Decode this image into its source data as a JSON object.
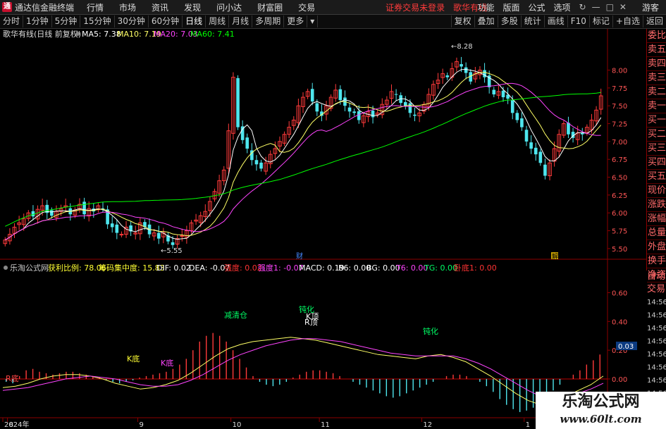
{
  "app": {
    "title": "通达信金融终端",
    "user": "游客"
  },
  "menu": [
    "行情",
    "市场",
    "资讯",
    "发现",
    "问小达",
    "财富圈",
    "交易"
  ],
  "notice": {
    "login": "证券交易未登录",
    "stock": "歌华有线"
  },
  "menu_right": [
    "功能",
    "版面",
    "公式",
    "选项"
  ],
  "periods": [
    "分时",
    "1分钟",
    "5分钟",
    "15分钟",
    "30分钟",
    "60分钟",
    "日线",
    "周线",
    "月线",
    "多周期",
    "更多"
  ],
  "active_period": "日线",
  "toolbar_right": [
    "复权",
    "叠加",
    "多股",
    "统计",
    "画线",
    "F10",
    "标记",
    "+自选",
    "返回"
  ],
  "side_items": [
    "委比",
    "卖五",
    "卖四",
    "卖三",
    "卖二",
    "卖一",
    "买一",
    "买二",
    "买三",
    "买四",
    "买五",
    "现价",
    "涨跌",
    "涨幅",
    "总量",
    "外盘",
    "换手",
    "净资",
    "收益"
  ],
  "side_items_2": [
    "自动",
    "交易"
  ],
  "watermark": {
    "title": "乐淘公式网",
    "url": "www.60lt.com"
  },
  "main_legend": {
    "name": "歌华有线(日线 前复权)",
    "ma": [
      {
        "label": "MA5: 7.38",
        "color": "#ffffff"
      },
      {
        "label": "MA10: 7.19",
        "color": "#ffff66"
      },
      {
        "label": "MA20: 7.03",
        "color": "#ff44ff"
      },
      {
        "label": "MA60: 7.41",
        "color": "#00ff00"
      }
    ]
  },
  "sub_legend": [
    {
      "label": "乐淘公式网",
      "color": "#cccccc"
    },
    {
      "label": "获利比例: 78.06",
      "color": "#ffff33"
    },
    {
      "label": "筹码集中度: 15.83",
      "color": "#ffff33"
    },
    {
      "label": "DIF: 0.02",
      "color": "#ffffff"
    },
    {
      "label": "DEA: -0.07",
      "color": "#ffffff"
    },
    {
      "label": "强度: 0.02",
      "color": "#ff3333"
    },
    {
      "label": "强度1: -0.07",
      "color": "#ff44ff"
    },
    {
      "label": "MACD: 0.19",
      "color": "#ffffff"
    },
    {
      "label": "B6: 0.00",
      "color": "#ffffff"
    },
    {
      "label": "BG: 0.00",
      "color": "#ffffff"
    },
    {
      "label": "T6: 0.00",
      "color": "#ff44ff"
    },
    {
      "label": "TG: 0.00",
      "color": "#00ff66"
    },
    {
      "label": "卧底1: 0.00",
      "color": "#ff3333"
    }
  ],
  "annotations": {
    "high_label": "8.28",
    "low_label": "5.55",
    "cai_label": "财",
    "jie_label": "解",
    "sub_labels": [
      {
        "text": "R底",
        "color": "#ff4444"
      },
      {
        "text": "K底",
        "color": "#ffff33"
      },
      {
        "text": "K底",
        "color": "#ff44ff"
      },
      {
        "text": "减清仓",
        "color": "#00ff66"
      },
      {
        "text": "钝化",
        "color": "#00ff66"
      },
      {
        "text": "K顶",
        "color": "#ffffff"
      },
      {
        "text": "R顶",
        "color": "#ffffff"
      },
      {
        "text": "钝化",
        "color": "#00ff66"
      }
    ],
    "macd_value": "0.03"
  },
  "chart_data": {
    "type": "candlestick",
    "price_axis": {
      "ticks": [
        5.5,
        5.75,
        6.0,
        6.25,
        6.5,
        6.75,
        7.0,
        7.25,
        7.5,
        7.75,
        8.0
      ],
      "range": [
        5.4,
        8.4
      ]
    },
    "sub_axis": {
      "ticks": [
        -0.2,
        0.0,
        0.2,
        0.4,
        0.6
      ],
      "range": [
        -0.25,
        0.72
      ]
    },
    "date_axis": [
      {
        "label": "2024年",
        "index": 0
      },
      {
        "label": "8",
        "index": 1
      },
      {
        "label": "9",
        "index": 29
      },
      {
        "label": "10",
        "index": 49
      },
      {
        "label": "11",
        "index": 68
      },
      {
        "label": "12",
        "index": 90
      },
      {
        "label": "1",
        "index": 112
      }
    ],
    "right_time_ticks": [
      "14:56",
      "14:56",
      "14:56",
      "14:56",
      "14:56",
      "14:56",
      "14:56",
      "14:56"
    ],
    "closes": [
      5.62,
      5.7,
      5.8,
      5.86,
      5.92,
      6.0,
      5.95,
      6.05,
      6.1,
      6.0,
      5.96,
      6.02,
      6.06,
      6.1,
      5.98,
      6.04,
      6.12,
      5.98,
      6.06,
      6.02,
      6.1,
      6.06,
      5.84,
      5.8,
      5.72,
      5.7,
      5.8,
      5.74,
      5.72,
      5.86,
      5.8,
      5.7,
      5.72,
      5.64,
      5.72,
      5.6,
      5.55,
      5.64,
      5.68,
      5.75,
      5.86,
      5.9,
      5.96,
      6.02,
      6.16,
      6.3,
      6.45,
      6.6,
      7.15,
      7.9,
      7.2,
      7.02,
      6.9,
      6.74,
      6.68,
      6.62,
      6.7,
      6.82,
      6.9,
      7.0,
      7.1,
      7.2,
      7.3,
      7.5,
      7.62,
      7.7,
      7.56,
      7.42,
      7.36,
      7.5,
      7.62,
      7.72,
      7.58,
      7.5,
      7.42,
      7.4,
      7.3,
      7.36,
      7.42,
      7.34,
      7.4,
      7.52,
      7.58,
      7.7,
      7.66,
      7.54,
      7.5,
      7.4,
      7.36,
      7.4,
      7.52,
      7.66,
      7.8,
      7.86,
      7.95,
      7.9,
      8.02,
      8.12,
      8.05,
      7.96,
      7.84,
      7.96,
      8.0,
      7.9,
      7.76,
      7.66,
      7.7,
      7.62,
      7.6,
      7.4,
      7.3,
      7.2,
      7.0,
      6.9,
      6.82,
      6.7,
      6.52,
      6.7,
      6.9,
      7.1,
      7.25,
      7.1,
      7.05,
      7.12,
      7.1,
      7.2,
      7.3,
      7.44,
      7.64
    ],
    "ma": [
      {
        "name": "MA5",
        "color": "#ffffff",
        "values": []
      },
      {
        "name": "MA10",
        "color": "#ffff66",
        "values": []
      },
      {
        "name": "MA20",
        "color": "#ff44ff",
        "values": []
      },
      {
        "name": "MA60",
        "color": "#00ff00",
        "values": []
      }
    ],
    "macd_hist": [
      -0.02,
      -0.03,
      0.02,
      0.06,
      0.07,
      0.05,
      0.04,
      0.03,
      0.04,
      0.05,
      0.05,
      0.04,
      0.03,
      0.02,
      0.01,
      -0.01,
      -0.02,
      -0.03,
      -0.02,
      -0.01,
      0.01,
      0.02,
      0.03,
      0.04,
      0.05,
      0.07,
      0.1,
      0.14,
      0.2,
      0.26,
      0.3,
      0.32,
      0.3,
      0.26,
      0.2,
      0.14,
      0.08,
      0.02,
      -0.02,
      -0.04,
      -0.05,
      -0.04,
      -0.02,
      0.01,
      0.03,
      0.05,
      0.06,
      0.06,
      0.05,
      0.04,
      0.02,
      0.0,
      -0.02,
      -0.04,
      -0.06,
      -0.08,
      -0.1,
      -0.12,
      -0.13,
      -0.12,
      -0.1,
      -0.08,
      -0.06,
      -0.04,
      -0.02,
      0.0,
      0.02,
      0.03,
      0.03,
      0.02,
      0.0,
      -0.02,
      -0.05,
      -0.09,
      -0.14,
      -0.18,
      -0.21,
      -0.23,
      -0.22,
      -0.2,
      -0.16,
      -0.12,
      -0.08,
      -0.04,
      0.0,
      0.03,
      0.06,
      0.1,
      0.13,
      0.17
    ],
    "dif": [
      -0.06,
      -0.05,
      -0.03,
      0.0,
      0.02,
      0.03,
      0.03,
      0.02,
      0.0,
      -0.03,
      -0.05,
      -0.07,
      -0.06,
      -0.04,
      -0.01,
      0.04,
      0.1,
      0.16,
      0.21,
      0.24,
      0.26,
      0.27,
      0.28,
      0.29,
      0.28,
      0.27,
      0.25,
      0.23,
      0.21,
      0.19,
      0.17,
      0.16,
      0.15,
      0.14,
      0.16,
      0.17,
      0.15,
      0.12,
      0.07,
      0.02,
      -0.04,
      -0.1,
      -0.15,
      -0.18,
      -0.16,
      -0.12,
      -0.08,
      -0.04,
      0.02
    ],
    "dea": [
      -0.08,
      -0.07,
      -0.06,
      -0.04,
      -0.02,
      0.0,
      0.01,
      0.02,
      0.01,
      0.0,
      -0.02,
      -0.04,
      -0.05,
      -0.05,
      -0.04,
      -0.01,
      0.03,
      0.08,
      0.13,
      0.17,
      0.2,
      0.23,
      0.25,
      0.27,
      0.28,
      0.28,
      0.27,
      0.26,
      0.24,
      0.22,
      0.2,
      0.18,
      0.17,
      0.16,
      0.16,
      0.16,
      0.16,
      0.14,
      0.11,
      0.07,
      0.02,
      -0.03,
      -0.08,
      -0.12,
      -0.14,
      -0.13,
      -0.1,
      -0.07,
      -0.03
    ]
  }
}
